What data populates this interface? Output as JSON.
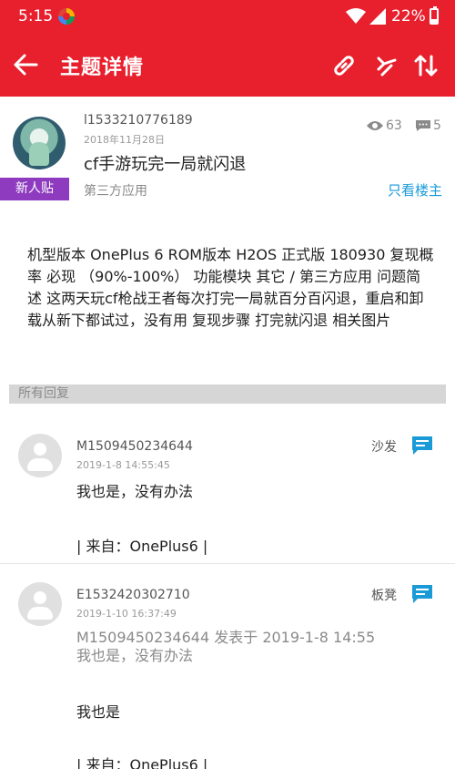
{
  "status_bar": {
    "time": "5:15",
    "battery": "22%"
  },
  "toolbar": {
    "title": "主题详情"
  },
  "post": {
    "author": "l1533210776189",
    "date": "2018年11月28日",
    "title": "cf手游玩完一局就闪退",
    "badge": "新人贴",
    "category": "第三方应用",
    "views": "63",
    "comments": "5",
    "only_author": "只看楼主",
    "body": "机型版本 OnePlus 6 ROM版本 H2OS 正式版 180930 复现概率 必现 （90%-100%） 功能模块 其它 / 第三方应用 问题简述 这两天玩cf枪战王者每次打完一局就百分百闪退，重启和卸载从新下都试过，没有用 复现步骤 打完就闪退 相关图片"
  },
  "replies_header": "所有回复",
  "replies": [
    {
      "user": "M1509450234644",
      "time": "2019-1-8 14:55:45",
      "floor": "沙发",
      "text": "我也是，没有办法",
      "source": "| 来自：OnePlus6 |"
    },
    {
      "user": "E1532420302710",
      "time": "2019-1-10 16:37:49",
      "floor": "板凳",
      "quote_head": "M1509450234644 发表于 2019-1-8 14:55",
      "quote_text": "我也是，没有办法",
      "text": "我也是",
      "source": "| 来自：OnePlus6 |"
    }
  ],
  "colors": {
    "primary": "#e8202e",
    "badge": "#8e3bbf",
    "link": "#1a9bd7",
    "reply_icon": "#1a9bd7"
  },
  "icons": [
    "arrow-back-icon",
    "link-icon",
    "jump-icon",
    "sort-icon",
    "eye-icon",
    "comment-icon",
    "reply-icon",
    "avatar-icon"
  ]
}
